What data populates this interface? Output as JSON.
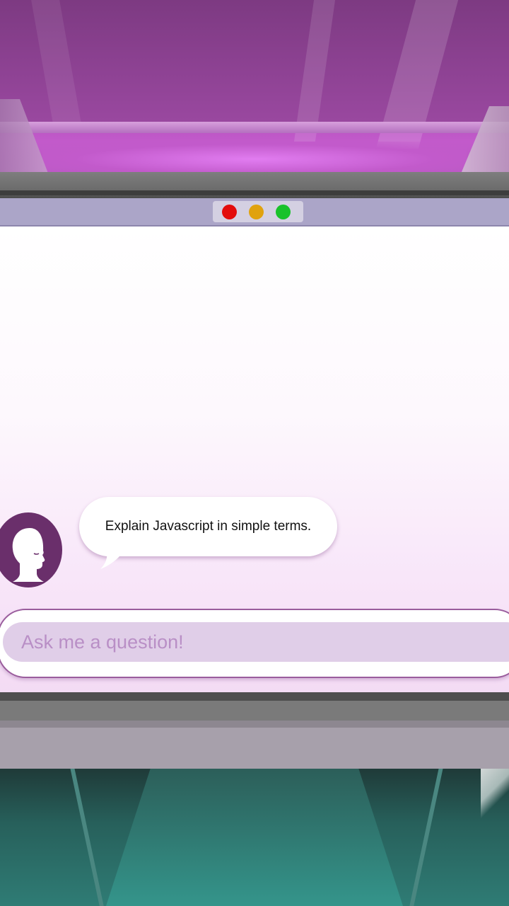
{
  "window": {
    "controls": [
      {
        "name": "close",
        "color": "#e30c0c"
      },
      {
        "name": "minimize",
        "color": "#e0a20e"
      },
      {
        "name": "maximize",
        "color": "#19c22a"
      }
    ]
  },
  "chat": {
    "messages": [
      {
        "sender": "user",
        "text": "Explain Javascript in simple terms."
      }
    ],
    "avatar_icon": "head-profile-icon"
  },
  "input": {
    "placeholder": "Ask me a question!",
    "value": ""
  },
  "colors": {
    "accent": "#6a2f6b",
    "input_fill": "#e0cee8",
    "titlebar": "#aba5c8"
  }
}
